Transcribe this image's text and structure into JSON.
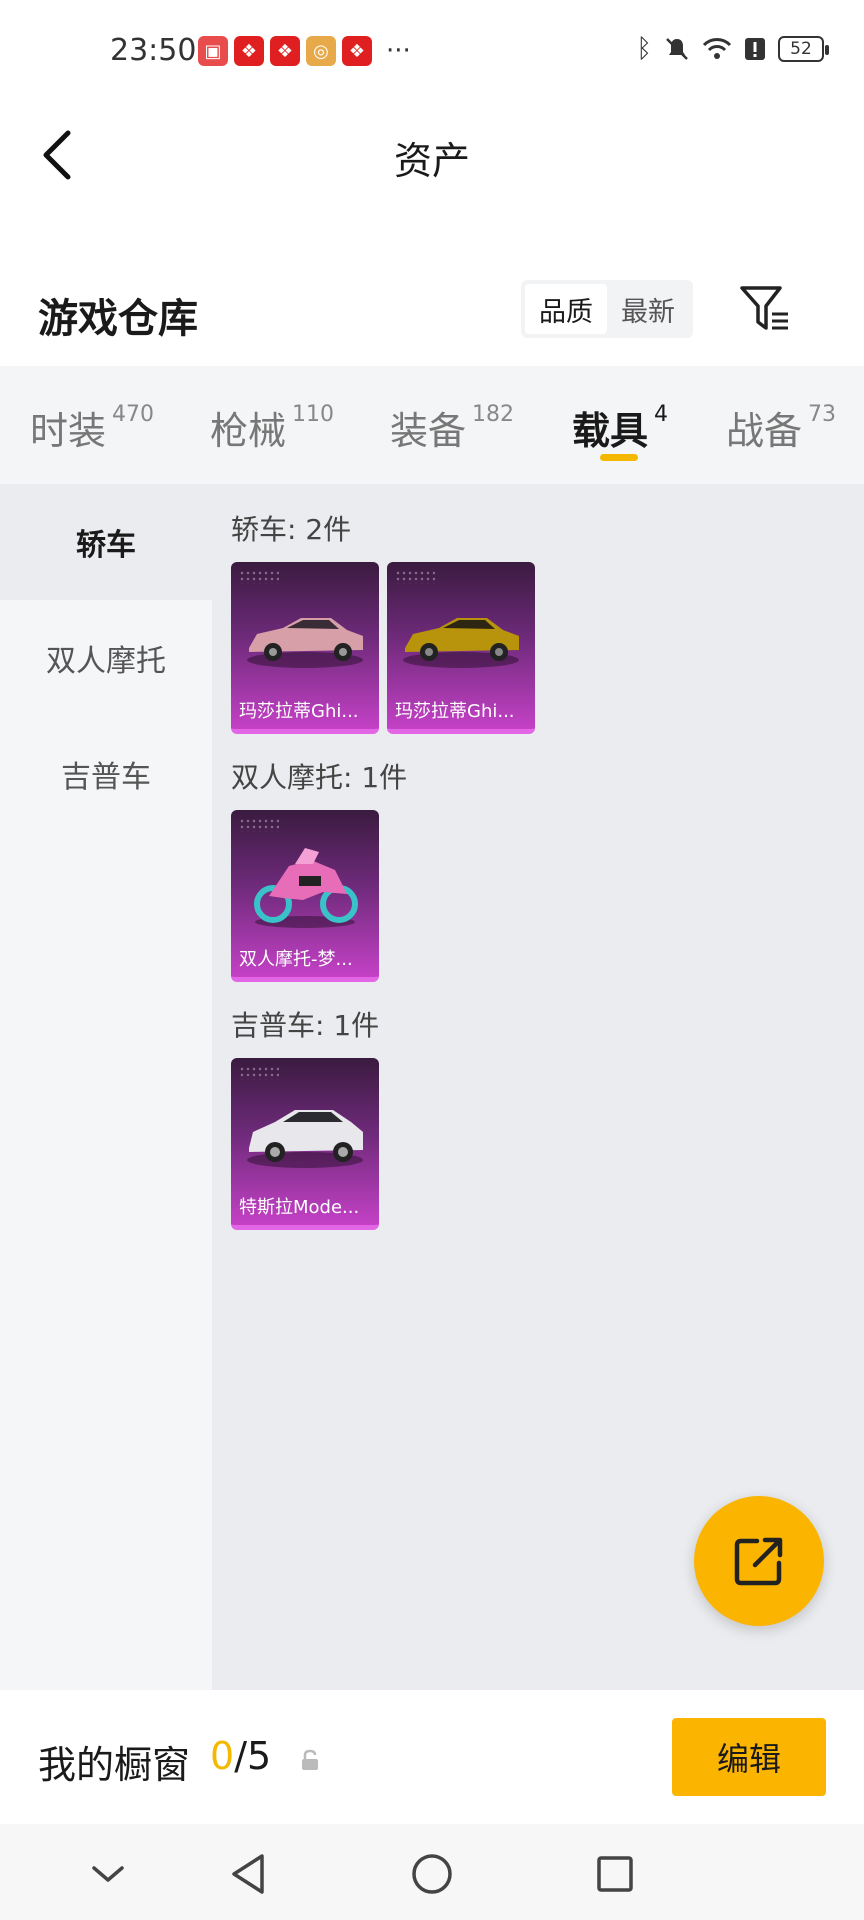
{
  "status_bar": {
    "time": "23:50",
    "notification_icons": [
      "huawei-store-icon",
      "app-notification-icon",
      "app-notification-icon",
      "target-app-icon",
      "app-notification-icon"
    ],
    "more": "···",
    "system_icons": [
      "bluetooth-icon",
      "mute-icon",
      "wifi-icon",
      "alert-icon"
    ],
    "battery": "52"
  },
  "header": {
    "title": "资产",
    "back_icon": "back-arrow-icon"
  },
  "warehouse": {
    "title": "游戏仓库",
    "sort_options": [
      "品质",
      "最新"
    ],
    "active_sort": "品质",
    "filter_icon": "filter-icon"
  },
  "tabs": [
    {
      "label": "时装",
      "count": "470"
    },
    {
      "label": "枪械",
      "count": "110"
    },
    {
      "label": "装备",
      "count": "182"
    },
    {
      "label": "载具",
      "count": "4",
      "active": true
    },
    {
      "label": "战备",
      "count": "73"
    }
  ],
  "sidebar": {
    "items": [
      "轿车",
      "双人摩托",
      "吉普车"
    ],
    "active": "轿车"
  },
  "sections": [
    {
      "title": "轿车: 2件",
      "items": [
        {
          "label": "玛莎拉蒂Ghi...",
          "vehicle": "sedan",
          "color": "#d7a0a8"
        },
        {
          "label": "玛莎拉蒂Ghi...",
          "vehicle": "sedan",
          "color": "#b8930c"
        }
      ]
    },
    {
      "title": "双人摩托: 1件",
      "items": [
        {
          "label": "双人摩托-梦...",
          "vehicle": "motorcycle",
          "color": "#e86db8"
        }
      ]
    },
    {
      "title": "吉普车: 1件",
      "items": [
        {
          "label": "特斯拉Mode...",
          "vehicle": "suv",
          "color": "#e8e8ec"
        }
      ]
    }
  ],
  "fab": {
    "icon": "share-icon"
  },
  "showcase": {
    "title": "我的橱窗",
    "current": "0",
    "separator": "/",
    "max": "5",
    "lock_icon": "lock-icon",
    "edit_label": "编辑"
  },
  "nav_bar": {
    "icons": [
      "chevron-down-icon",
      "back-triangle-icon",
      "home-circle-icon",
      "recents-square-icon"
    ]
  },
  "colors": {
    "accent": "#fbb400",
    "card_gradient_top": "#3a1b3f",
    "card_gradient_bottom": "#c441c6"
  }
}
